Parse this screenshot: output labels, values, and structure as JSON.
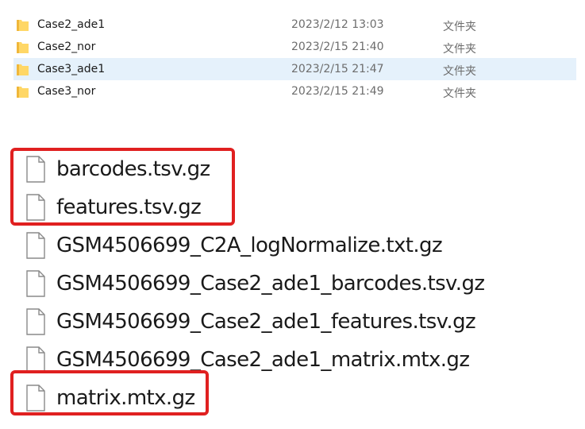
{
  "folders": [
    {
      "name": "Case2_ade1",
      "modified": "2023/2/12 13:03",
      "type": "文件夹",
      "selected": false
    },
    {
      "name": "Case2_nor",
      "modified": "2023/2/15 21:40",
      "type": "文件夹",
      "selected": false
    },
    {
      "name": "Case3_ade1",
      "modified": "2023/2/15 21:47",
      "type": "文件夹",
      "selected": true
    },
    {
      "name": "Case3_nor",
      "modified": "2023/2/15 21:49",
      "type": "文件夹",
      "selected": false
    }
  ],
  "files": [
    {
      "name": "barcodes.tsv.gz",
      "highlighted": true
    },
    {
      "name": "features.tsv.gz",
      "highlighted": true
    },
    {
      "name": "GSM4506699_C2A_logNormalize.txt.gz",
      "highlighted": false
    },
    {
      "name": "GSM4506699_Case2_ade1_barcodes.tsv.gz",
      "highlighted": false
    },
    {
      "name": "GSM4506699_Case2_ade1_features.tsv.gz",
      "highlighted": false
    },
    {
      "name": "GSM4506699_Case2_ade1_matrix.mtx.gz",
      "highlighted": false
    },
    {
      "name": "matrix.mtx.gz",
      "highlighted": true
    }
  ],
  "colors": {
    "selection": "#e5f1fb",
    "annotation_red": "#e02020",
    "folder_yellow": "#ffd766"
  },
  "icons": {
    "folder": "folder-icon",
    "file": "file-icon"
  }
}
